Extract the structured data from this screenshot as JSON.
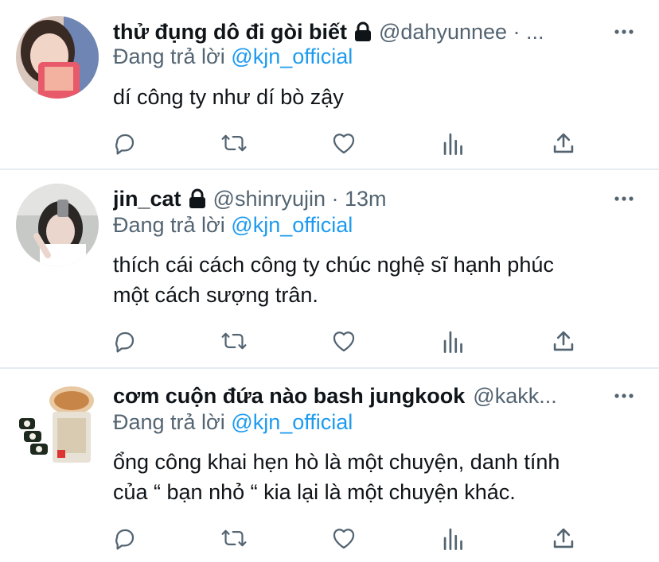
{
  "tweets": [
    {
      "name": "thử đụng dô đi gòi biết",
      "handle_meta": "@dahyunnee · ...",
      "replying_prefix": "Đang trả lời",
      "replying_to": "@kjn_official",
      "text_lines": [
        "dí công ty như dí bò zậy"
      ]
    },
    {
      "name": "jin_cat",
      "handle_meta": "@shinryujin · 13m",
      "replying_prefix": "Đang trả lời",
      "replying_to": "@kjn_official",
      "text_lines": [
        "thích cái cách công ty chúc nghệ sĩ hạnh phúc",
        "một cách sượng trân."
      ]
    },
    {
      "name": "cơm cuộn đứa nào bash jungkook",
      "handle_meta": "@kakk...",
      "replying_prefix": "Đang trả lời",
      "replying_to": "@kjn_official",
      "text_lines": [
        "ổng công khai hẹn hò là một chuyện, danh tính",
        "của “ bạn nhỏ “ kia lại là một chuyện khác."
      ]
    }
  ],
  "icons": {
    "more": "more-dots-icon",
    "lock": "lock-icon",
    "reply": "reply-bubble-icon",
    "retweet": "retweet-icon",
    "like": "heart-icon",
    "analytics": "analytics-bars-icon",
    "share": "share-upload-icon"
  },
  "colors": {
    "text": "#0f1419",
    "secondary": "#536471",
    "mention": "#1d9bf0",
    "divider": "#e6ecf0"
  }
}
